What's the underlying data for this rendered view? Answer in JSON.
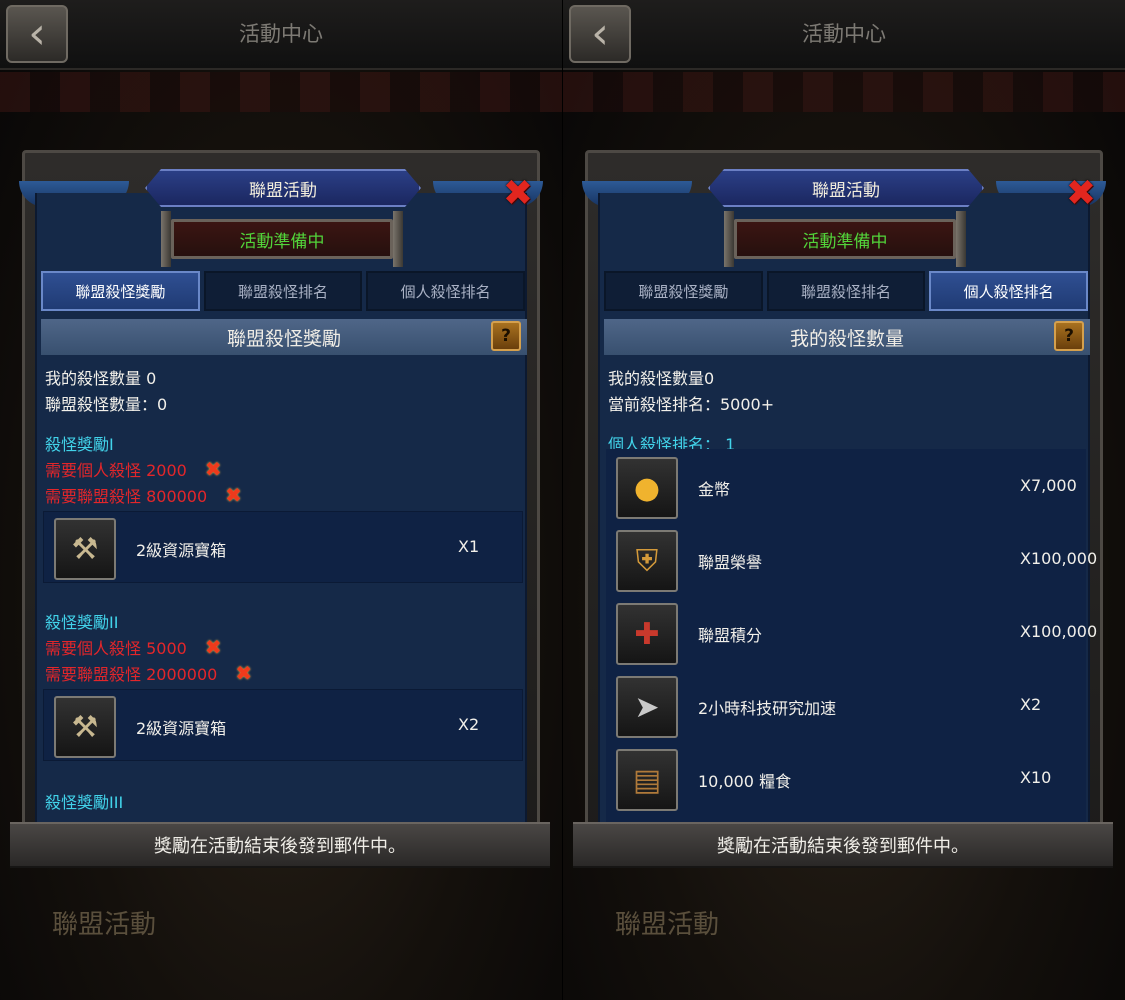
{
  "screens": [
    {
      "topbar_title": "活動中心",
      "bottom_label": "聯盟活動",
      "panel_title": "聯盟活動",
      "status": "活動準備中",
      "tabs": [
        "聯盟殺怪獎勵",
        "聯盟殺怪排名",
        "個人殺怪排名"
      ],
      "active_tab": 0,
      "section_title": "聯盟殺怪獎勵",
      "help_label": "?",
      "info_lines": [
        "我的殺怪數量 0",
        "聯盟殺怪數量：0"
      ],
      "tiers": [
        {
          "title": "殺怪獎勵I",
          "requirements": [
            "需要個人殺怪 2000",
            "需要聯盟殺怪 800000"
          ],
          "reward": {
            "name": "2級資源寶箱",
            "qty": "X1",
            "icon": "resource-chest-icon"
          }
        },
        {
          "title": "殺怪獎勵II",
          "requirements": [
            "需要個人殺怪 5000",
            "需要聯盟殺怪 2000000"
          ],
          "reward": {
            "name": "2級資源寶箱",
            "qty": "X2",
            "icon": "resource-chest-icon"
          }
        },
        {
          "title": "殺怪獎勵III"
        }
      ],
      "footer": "獎勵在活動結束後發到郵件中。"
    },
    {
      "topbar_title": "活動中心",
      "bottom_label": "聯盟活動",
      "panel_title": "聯盟活動",
      "status": "活動準備中",
      "tabs": [
        "聯盟殺怪獎勵",
        "聯盟殺怪排名",
        "個人殺怪排名"
      ],
      "active_tab": 2,
      "section_title": "我的殺怪數量",
      "help_label": "?",
      "info_lines": [
        "我的殺怪數量0",
        "當前殺怪排名：5000+"
      ],
      "rank_label": "個人殺怪排名：  1",
      "rewards": [
        {
          "name": "金幣",
          "qty": "X7,000",
          "icon": "gold-coin-icon"
        },
        {
          "name": "聯盟榮譽",
          "qty": "X100,000",
          "icon": "alliance-honor-icon"
        },
        {
          "name": "聯盟積分",
          "qty": "X100,000",
          "icon": "alliance-points-icon"
        },
        {
          "name": "2小時科技研究加速",
          "qty": "X2",
          "icon": "research-speedup-icon"
        },
        {
          "name": "10,000 糧食",
          "qty": "X10",
          "icon": "food-crate-icon"
        }
      ],
      "footer": "獎勵在活動結束後發到郵件中。"
    }
  ],
  "colors": {
    "panel_blue": "#152948",
    "tab_active": "#2f4f92",
    "status_green": "#52d43a",
    "requirement_red": "#e3262a",
    "tier_cyan": "#42d3ea",
    "close_red": "#e2261f"
  }
}
